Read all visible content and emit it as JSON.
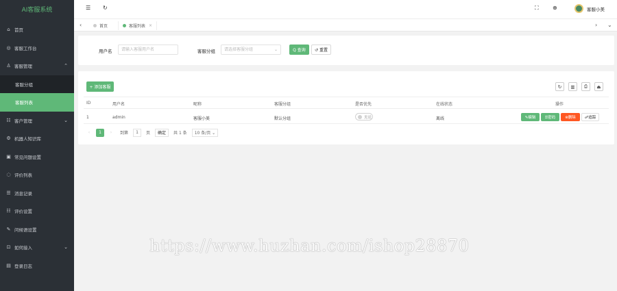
{
  "sidebar": {
    "logo": "AI客服系统",
    "items": [
      {
        "icon": "home-icon",
        "glyph": "⌂",
        "label": "首页"
      },
      {
        "icon": "headset-icon",
        "glyph": "◎",
        "label": "客服工作台"
      },
      {
        "icon": "user-icon",
        "glyph": "♙",
        "label": "客服管理",
        "chevron": "⌃"
      },
      {
        "icon": "",
        "glyph": "",
        "label": "客服分组"
      },
      {
        "icon": "",
        "glyph": "",
        "label": "客服列表"
      },
      {
        "icon": "customer-icon",
        "glyph": "☷",
        "label": "客户管理",
        "chevron": "⌄"
      },
      {
        "icon": "robot-icon",
        "glyph": "⚙",
        "label": "机器人知识库"
      },
      {
        "icon": "reply-icon",
        "glyph": "▣",
        "label": "常见问题设置"
      },
      {
        "icon": "comment-icon",
        "glyph": "◌",
        "label": "评价列表"
      },
      {
        "icon": "history-icon",
        "glyph": "☰",
        "label": "消息记录"
      },
      {
        "icon": "settings-icon",
        "glyph": "☷",
        "label": "评价设置"
      },
      {
        "icon": "words-icon",
        "glyph": "✎",
        "label": "问候语设置"
      },
      {
        "icon": "access-icon",
        "glyph": "⊡",
        "label": "如何接入",
        "chevron": "⌄"
      },
      {
        "icon": "log-icon",
        "glyph": "▤",
        "label": "登录日志"
      }
    ]
  },
  "header": {
    "menu_glyph": "☰",
    "refresh_glyph": "↻",
    "fullscreen_glyph": "⛶",
    "globe_glyph": "⊕",
    "user_name": "客服小美"
  },
  "tabs": {
    "prev_glyph": "‹",
    "next_glyph": "›",
    "more_glyph": "⌄",
    "items": [
      {
        "label": "首页"
      },
      {
        "label": "客服列表",
        "close": "×"
      }
    ]
  },
  "search": {
    "username_label": "用户名",
    "username_placeholder": "请输入客服用户名",
    "group_label": "客服分组",
    "group_placeholder": "请选择客服分组",
    "group_arrow": "⌄",
    "search_button": "Q 查询",
    "reset_button": "↺ 重置"
  },
  "table": {
    "add_button": "+ 添加客服",
    "tools": [
      "↻",
      "▥",
      "⎙",
      "⏏"
    ],
    "columns": [
      "ID",
      "用户名",
      "昵称",
      "客服分组",
      "是否优先",
      "在线状态",
      "操作"
    ],
    "rows": [
      {
        "id": "1",
        "username": "admin",
        "nickname": "客服小美",
        "group": "默认分组",
        "priority": "无论",
        "status": "离线"
      }
    ],
    "actions": [
      "✎编辑",
      "⚿密码",
      "⊗删除",
      "☍追踪"
    ]
  },
  "pager": {
    "prev": "‹",
    "current": "1",
    "next": "›",
    "goto_label": "到第",
    "goto_value": "1",
    "page_unit": "页",
    "confirm": "确定",
    "total": "共 1 条",
    "size": "10 条/页 ⌄"
  },
  "watermark": "https://www.huzhan.com/ishop28870"
}
